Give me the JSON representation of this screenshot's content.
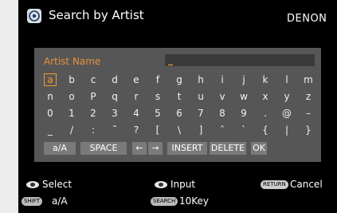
{
  "title_bar": {
    "title": "Search by Artist",
    "brand": "DENON",
    "icon": "search-artist-icon"
  },
  "field": {
    "label": "Artist Name",
    "cursor": "_"
  },
  "keyboard": {
    "rows": [
      [
        "a",
        "b",
        "c",
        "d",
        "e",
        "f",
        "g",
        "h",
        "i",
        "j",
        "k",
        "l",
        "m"
      ],
      [
        "n",
        "o",
        "P",
        "q",
        "r",
        "s",
        "t",
        "u",
        "v",
        "w",
        "x",
        "y",
        "z"
      ],
      [
        "0",
        "1",
        "2",
        "3",
        "4",
        "5",
        "6",
        "7",
        "8",
        "9",
        ".",
        "@",
        "–"
      ],
      [
        "_",
        "/",
        ":",
        "˜",
        "?",
        "[",
        "\\",
        "]",
        "ˆ",
        "`",
        "{",
        "|",
        "}"
      ]
    ],
    "selected_key": "a",
    "function_keys": {
      "case": "a/A",
      "space": "SPACE",
      "left": "←",
      "right": "→",
      "insert": "INSERT",
      "delete": "DELETE",
      "ok": "OK"
    }
  },
  "footer": {
    "select_label": "Select",
    "input_label": "Input",
    "return_badge": "RETURN",
    "cancel_label": "Cancel",
    "shift_badge": "SHIFT",
    "shift_label": "a/A",
    "search_badge": "SEARCH",
    "search_label": "10Key"
  }
}
